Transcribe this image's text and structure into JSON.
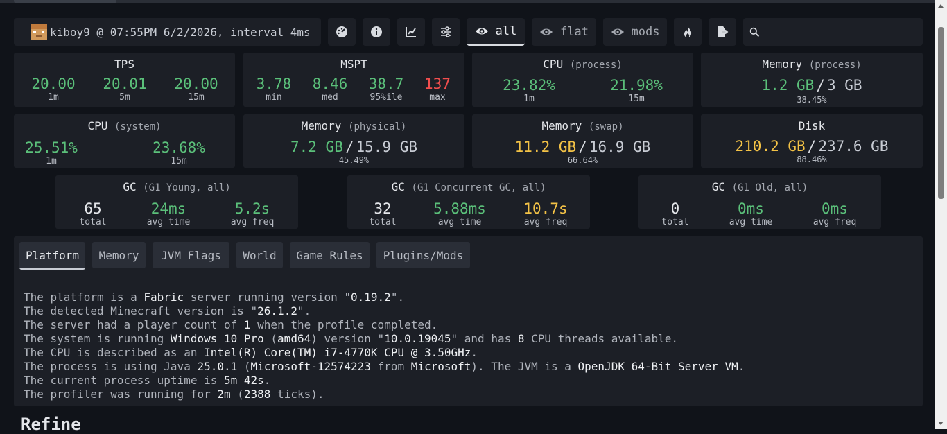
{
  "header": {
    "user": "kiboy9 @ 07:55PM 6/2/2026, interval 4ms",
    "buttons": [
      {
        "icon": "gauge-icon"
      },
      {
        "icon": "info-icon"
      },
      {
        "icon": "chart-icon"
      },
      {
        "icon": "sliders-icon"
      },
      {
        "icon": "eye-icon",
        "label": "all"
      },
      {
        "icon": "eye-icon",
        "label": "flat"
      },
      {
        "icon": "eye-icon",
        "label": "mods"
      },
      {
        "icon": "flame-icon"
      },
      {
        "icon": "export-icon"
      }
    ],
    "search_placeholder": ""
  },
  "cards": {
    "tps": {
      "title": "TPS",
      "values": [
        {
          "v": "20.00",
          "l": "1m"
        },
        {
          "v": "20.01",
          "l": "5m"
        },
        {
          "v": "20.00",
          "l": "15m"
        }
      ]
    },
    "mspt": {
      "title": "MSPT",
      "values": [
        {
          "v": "3.78",
          "l": "min"
        },
        {
          "v": "8.46",
          "l": "med"
        },
        {
          "v": "38.7",
          "l": "95%ile"
        },
        {
          "v": "137",
          "l": "max"
        }
      ]
    },
    "cpu_process": {
      "title": "CPU",
      "sub": "(process)",
      "values": [
        {
          "v": "23.82%",
          "l": "1m"
        },
        {
          "v": "21.98%",
          "l": "15m"
        }
      ]
    },
    "memory_process": {
      "title": "Memory",
      "sub": "(process)",
      "used": "1.2 GB",
      "sep": "/",
      "total": "3 GB",
      "pct": "38.45%"
    },
    "cpu_system": {
      "title": "CPU",
      "sub": "(system)",
      "values": [
        {
          "v": "25.51%",
          "l": "1m"
        },
        {
          "v": "23.68%",
          "l": "15m"
        }
      ]
    },
    "memory_physical": {
      "title": "Memory",
      "sub": "(physical)",
      "used": "7.2 GB",
      "sep": "/",
      "total": "15.9 GB",
      "pct": "45.49%"
    },
    "memory_swap": {
      "title": "Memory",
      "sub": "(swap)",
      "used": "11.2 GB",
      "sep": "/",
      "total": "16.9 GB",
      "pct": "66.64%"
    },
    "disk": {
      "title": "Disk",
      "used": "210.2 GB",
      "sep": "/",
      "total": "237.6 GB",
      "pct": "88.46%"
    },
    "gc_young": {
      "title": "GC",
      "sub": "(G1 Young, all)",
      "values": [
        {
          "v": "65",
          "l": "total"
        },
        {
          "v": "24ms",
          "l": "avg time"
        },
        {
          "v": "5.2s",
          "l": "avg freq"
        }
      ]
    },
    "gc_concurrent": {
      "title": "GC",
      "sub": "(G1 Concurrent GC, all)",
      "values": [
        {
          "v": "32",
          "l": "total"
        },
        {
          "v": "5.88ms",
          "l": "avg time"
        },
        {
          "v": "10.7s",
          "l": "avg freq"
        }
      ]
    },
    "gc_old": {
      "title": "GC",
      "sub": "(G1 Old, all)",
      "values": [
        {
          "v": "0",
          "l": "total"
        },
        {
          "v": "0ms",
          "l": "avg time"
        },
        {
          "v": "0ms",
          "l": "avg freq"
        }
      ]
    }
  },
  "colors": {
    "good": "#5bc07a",
    "warn": "#f3c246",
    "bad": "#f24e4e"
  },
  "tabs": [
    "Platform",
    "Memory",
    "JVM Flags",
    "World",
    "Game Rules",
    "Plugins/Mods"
  ],
  "platform_info": {
    "l1": [
      "The platform is a ",
      "Fabric",
      " server running version \"",
      "0.19.2",
      "\"."
    ],
    "l2": [
      "The detected Minecraft version is \"",
      "26.1.2",
      "\"."
    ],
    "l3": [
      "The server had a player count of ",
      "1",
      " when the profile completed."
    ],
    "l4": [
      "The system is running ",
      "Windows 10 Pro",
      " (",
      "amd64",
      ") version \"",
      "10.0.19045",
      "\" and has ",
      "8",
      " CPU threads available."
    ],
    "l5": [
      "The CPU is described as an ",
      "Intel(R) Core(TM) i7-4770K CPU @ 3.50GHz",
      "."
    ],
    "l6": [
      "The process is using Java ",
      "25.0.1",
      " (",
      "Microsoft-12574223",
      " from ",
      "Microsoft",
      "). The JVM is a ",
      "OpenJDK 64-Bit Server VM",
      "."
    ],
    "l7": [
      "The current process uptime is ",
      "5m 42s",
      "."
    ],
    "l8": [
      "The profiler was running for ",
      "2m",
      " (",
      "2388",
      " ticks)."
    ]
  },
  "next_section": "Refine"
}
